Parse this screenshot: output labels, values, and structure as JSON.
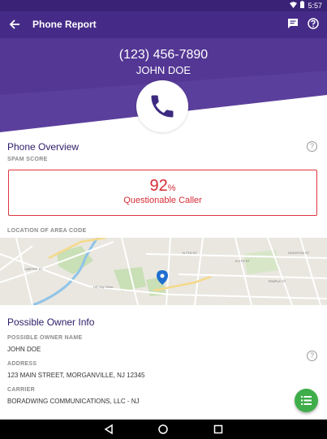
{
  "status_bar": {
    "time": "5:57"
  },
  "app_bar": {
    "title": "Phone Report",
    "back_icon": "arrow-back-icon",
    "message_icon": "message-icon",
    "help_icon": "help-icon"
  },
  "header": {
    "phone_number": "(123) 456-7890",
    "name": "JOHN DOE",
    "avatar_icon": "phone-icon"
  },
  "overview": {
    "title": "Phone Overview",
    "spam_label": "SPAM SCORE",
    "spam_score": "92",
    "spam_unit": "%",
    "spam_status": "Questionable Caller",
    "location_label": "LOCATION OF AREA CODE"
  },
  "owner_info": {
    "title": "Possible Owner Info",
    "name_label": "POSSIBLE OWNER NAME",
    "name_value": "JOHN DOE",
    "address_label": "ADDRESS",
    "address_value": "123 MAIN STREET, MORGANVILLE, NJ 12345",
    "carrier_label": "CARRIER",
    "carrier_value": "BORADWING COMMUNICATIONS, LLC - NJ"
  },
  "colors": {
    "primary": "#452b87",
    "status_bar": "#3a2277",
    "spam_red": "#d62b36",
    "fab_green": "#3fae4a"
  },
  "fab": {
    "icon": "list-icon"
  },
  "nav_bar": {
    "back_icon": "nav-back-icon",
    "home_icon": "nav-home-icon",
    "recents_icon": "nav-recents-icon"
  }
}
